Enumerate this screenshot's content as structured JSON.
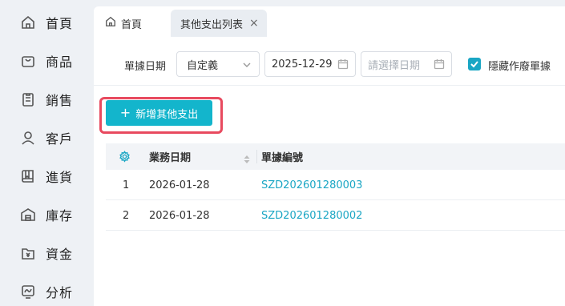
{
  "sidebar": {
    "items": [
      {
        "label": "首頁",
        "icon": "home-icon"
      },
      {
        "label": "商品",
        "icon": "bag-icon"
      },
      {
        "label": "銷售",
        "icon": "clipboard-icon"
      },
      {
        "label": "客戶",
        "icon": "user-icon"
      },
      {
        "label": "進貨",
        "icon": "book-icon"
      },
      {
        "label": "庫存",
        "icon": "warehouse-icon"
      },
      {
        "label": "資金",
        "icon": "wallet-icon"
      },
      {
        "label": "分析",
        "icon": "chart-icon"
      }
    ]
  },
  "tabs": {
    "home_label": "首頁",
    "active_label": "其他支出列表",
    "close_glyph": "×"
  },
  "filter": {
    "label": "單據日期",
    "select_value": "自定義",
    "date_start": "2025-12-29",
    "date_end_placeholder": "請選擇日期",
    "checkbox_checked": true,
    "checkbox_label": "隱藏作廢單據"
  },
  "toolbar": {
    "add_plus": "+",
    "add_label": "新增其他支出"
  },
  "table": {
    "columns": [
      "業務日期",
      "單據編號"
    ],
    "rows": [
      {
        "index": "1",
        "date": "2026-01-28",
        "number": "SZD202601280003"
      },
      {
        "index": "2",
        "date": "2026-01-28",
        "number": "SZD202601280002"
      }
    ]
  },
  "colors": {
    "accent": "#13b5cc",
    "highlight": "#e84a5f",
    "link": "#1aa6c4"
  }
}
